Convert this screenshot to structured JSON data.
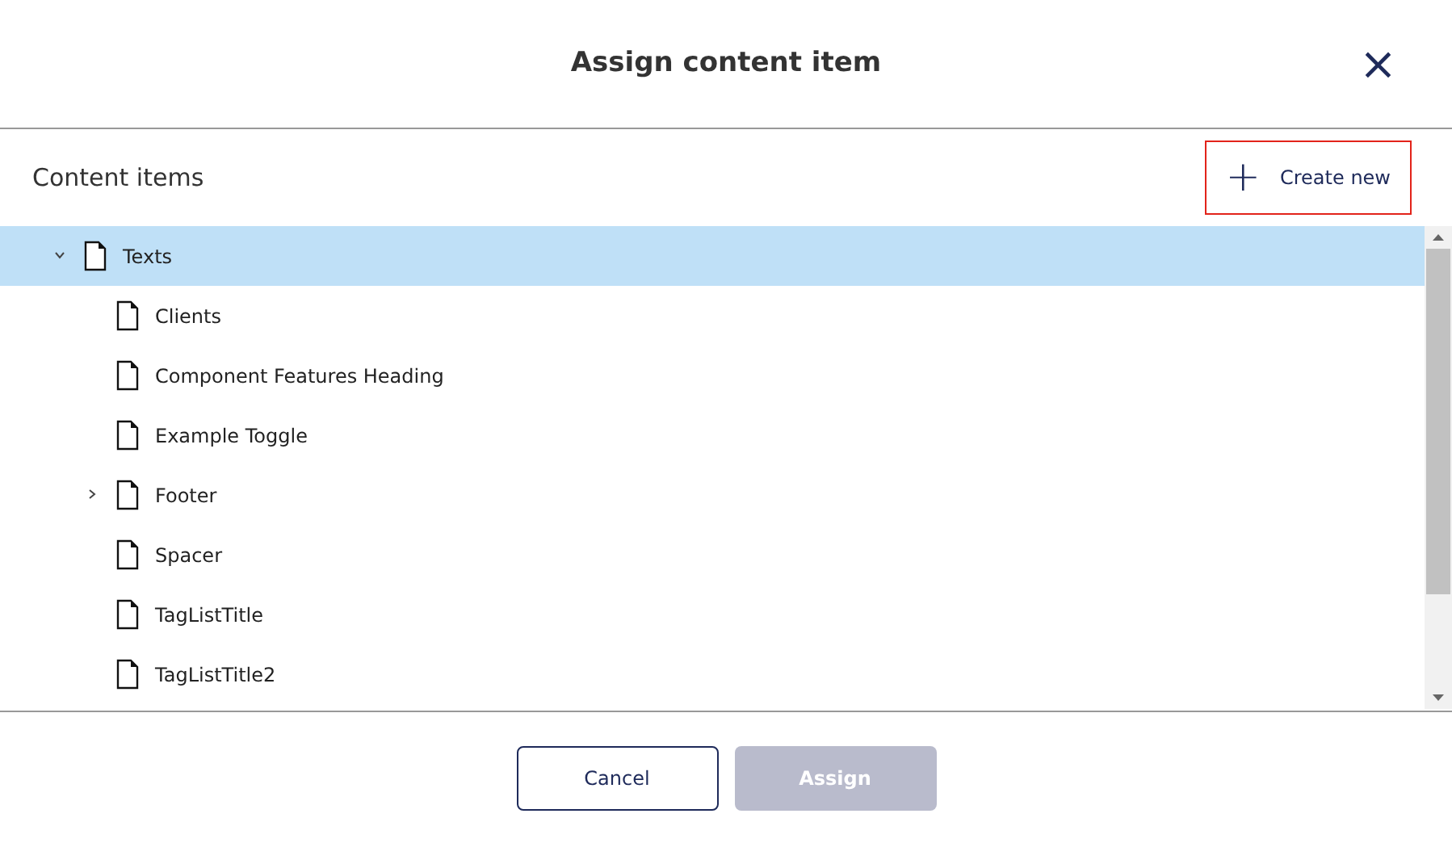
{
  "dialog": {
    "title": "Assign content item",
    "close": "×"
  },
  "panel": {
    "title": "Content items",
    "create_button": {
      "label": "Create new",
      "icon": "+"
    }
  },
  "tree": [
    {
      "label": "Texts",
      "selected": true,
      "expanded": true,
      "children": [
        {
          "label": "Clients",
          "selected": false
        },
        {
          "label": "Component Features Heading",
          "selected": false
        },
        {
          "label": "Example Toggle",
          "selected": false
        },
        {
          "label": "Footer",
          "selected": false,
          "expanded": false
        },
        {
          "label": "Spacer",
          "selected": false
        },
        {
          "label": "TagListTitle",
          "selected": false
        },
        {
          "label": "TagListTitle2",
          "selected": false
        }
      ]
    }
  ],
  "buttons": [
    {
      "label": "Cancel",
      "kind": "secondary",
      "disabled": false
    },
    {
      "label": "Assign",
      "kind": "primary",
      "disabled": true
    }
  ]
}
